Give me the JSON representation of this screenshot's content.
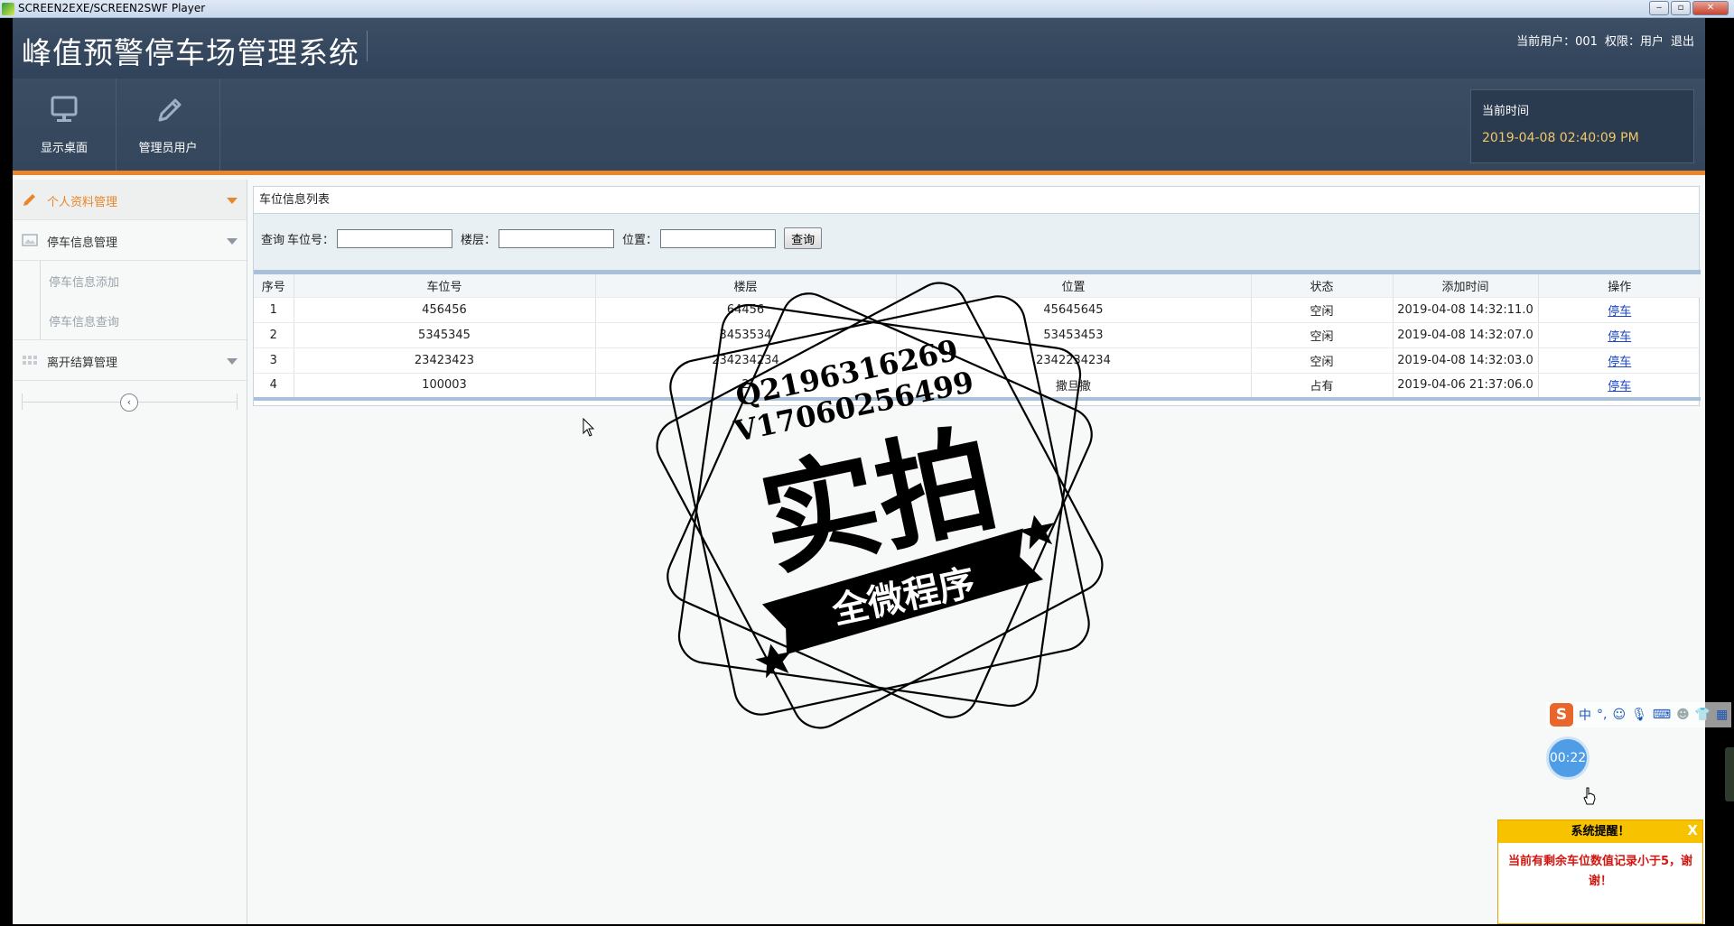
{
  "window": {
    "title": "SCREEN2EXE/SCREEN2SWF Player",
    "min_label": "‒",
    "max_label": "▫",
    "close_label": "✕"
  },
  "header": {
    "system_title": "峰值预警停车场管理系统",
    "current_user": "当前用户：001",
    "permission": "权限：用户",
    "logout": "退出"
  },
  "toolbar": {
    "items": [
      {
        "label": "显示桌面",
        "icon": "monitor-icon"
      },
      {
        "label": "管理员用户",
        "icon": "pencil-icon"
      }
    ],
    "clock_label": "当前时间",
    "clock_value": "2019-04-08 02:40:09 PM"
  },
  "sidebar": {
    "items": [
      {
        "label": "个人资料管理",
        "icon": "pencil-icon",
        "active": true
      },
      {
        "label": "停车信息管理",
        "icon": "image-icon",
        "active": false
      },
      {
        "label": "停车信息添加",
        "sub": true
      },
      {
        "label": "停车信息查询",
        "sub": true
      },
      {
        "label": "离开结算管理",
        "icon": "grid-icon",
        "active": false
      }
    ],
    "collapse_label": "‹"
  },
  "panel": {
    "title": "车位信息列表",
    "search": {
      "prefix": "查询",
      "slot_label": "车位号：",
      "floor_label": "楼层：",
      "location_label": "位置：",
      "button": "查询",
      "slot_value": "",
      "floor_value": "",
      "location_value": ""
    },
    "columns": [
      "序号",
      "车位号",
      "楼层",
      "位置",
      "状态",
      "添加时间",
      "操作"
    ],
    "rows": [
      {
        "no": "1",
        "slot": "456456",
        "floor": "64456",
        "location": "45645645",
        "status": "空闲",
        "time": "2019-04-08 14:32:11.0",
        "action": "停车"
      },
      {
        "no": "2",
        "slot": "5345345",
        "floor": "3453534",
        "location": "53453453",
        "status": "空闲",
        "time": "2019-04-08 14:32:07.0",
        "action": "停车"
      },
      {
        "no": "3",
        "slot": "23423423",
        "floor": "234234234",
        "location": "2342234234",
        "status": "空闲",
        "time": "2019-04-08 14:32:03.0",
        "action": "停车"
      },
      {
        "no": "4",
        "slot": "100003",
        "floor": "2",
        "location": "撒旦撒",
        "status": "占有",
        "time": "2019-04-06 21:37:06.0",
        "action": "停车"
      }
    ]
  },
  "watermark": {
    "line1": "Q2196316269",
    "line2": "V17060256499",
    "big": "实拍",
    "banner": "全微程序"
  },
  "ime": {
    "logo": "S",
    "mode": "中",
    "punct": "°,",
    "icons": [
      "emoji-icon",
      "microphone-icon",
      "keyboard-icon",
      "user-icon",
      "shirt-icon",
      "grid-icon"
    ]
  },
  "timer": "00:22",
  "toast": {
    "title": "系统提醒！",
    "close": "X",
    "message": "当前有剩余车位数值记录小于5，谢谢！"
  },
  "colors": {
    "header_bg": "#3c4e64",
    "accent_orange": "#e8862c",
    "clock_text": "#f2c86a",
    "link_blue": "#1a44c9",
    "toast_yellow": "#f7c200",
    "toast_text": "#d3160f"
  }
}
